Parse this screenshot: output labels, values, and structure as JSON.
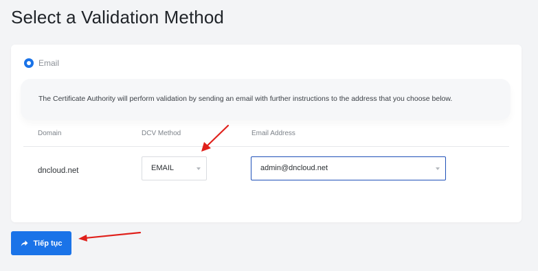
{
  "page": {
    "title": "Select a Validation Method"
  },
  "validation": {
    "option_label": "Email",
    "selected": true,
    "info_text": "The Certificate Authority will perform validation by sending an email with further instructions to the address that you choose below."
  },
  "table": {
    "headers": [
      "Domain",
      "DCV Method",
      "Email Address"
    ],
    "rows": [
      {
        "domain": "dncloud.net",
        "dcv_method": "EMAIL",
        "email": "admin@dncloud.net"
      }
    ]
  },
  "actions": {
    "continue_label": "Tiếp tục"
  },
  "icons": {
    "continue": "share-arrow-icon",
    "dropdown": "chevron-down-icon",
    "radio": "radio-selected-icon"
  },
  "colors": {
    "accent": "#1a73e8",
    "email_select_border": "#1d4fb8",
    "annotation": "#e0201b"
  }
}
